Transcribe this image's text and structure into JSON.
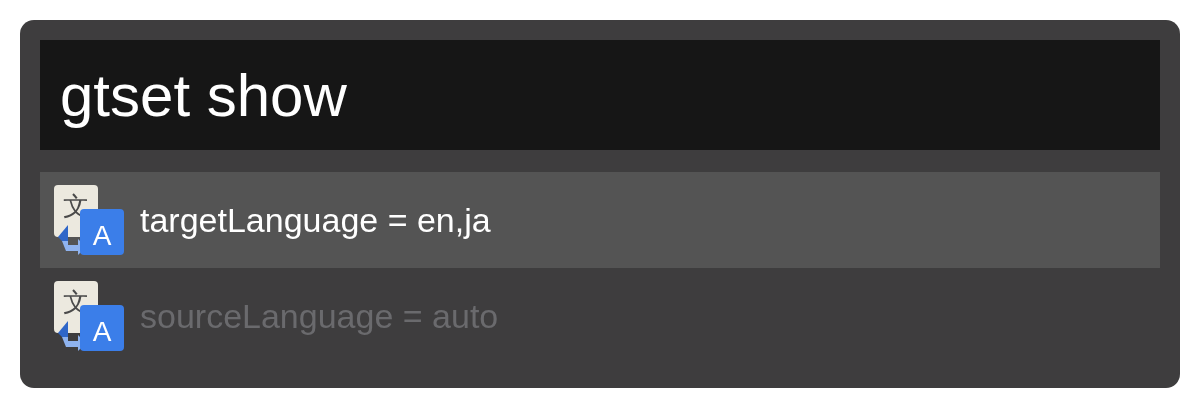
{
  "query": {
    "value": "gtset show"
  },
  "results": [
    {
      "icon": {
        "back": "文",
        "front": "A"
      },
      "title": "targetLanguage = en,ja",
      "selected": true
    },
    {
      "icon": {
        "back": "文",
        "front": "A"
      },
      "title": "sourceLanguage = auto",
      "selected": false
    }
  ]
}
